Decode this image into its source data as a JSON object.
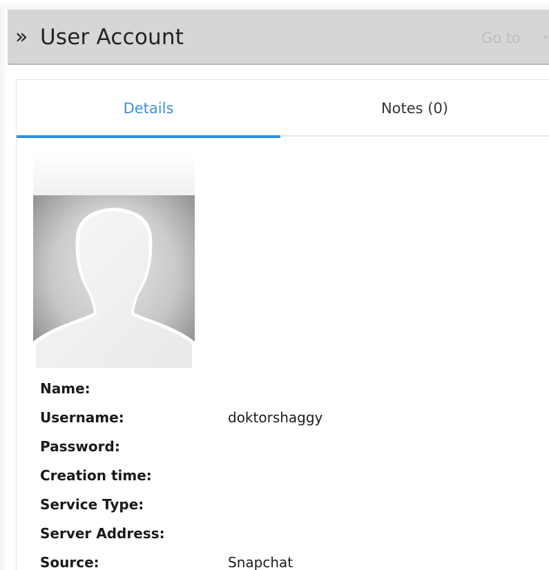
{
  "header": {
    "chevrons": "»",
    "title": "User Account",
    "goto_label": "Go to"
  },
  "tabs": [
    {
      "label": "Details",
      "active": true
    },
    {
      "label": "Notes (0)",
      "active": false
    }
  ],
  "avatar": {
    "icon": "default-user-silhouette"
  },
  "details": [
    {
      "label": "Name:",
      "value": ""
    },
    {
      "label": "Username:",
      "value": "doktorshaggy"
    },
    {
      "label": "Password:",
      "value": ""
    },
    {
      "label": "Creation time:",
      "value": ""
    },
    {
      "label": "Service Type:",
      "value": ""
    },
    {
      "label": "Server Address:",
      "value": ""
    },
    {
      "label": "Source:",
      "value": "Snapchat"
    }
  ],
  "colors": {
    "header_bg": "#d6d6d6",
    "active_tab_text": "#3c8fd6",
    "active_tab_underline": "#2b8fe0",
    "goto_text": "#bdbdbd"
  }
}
